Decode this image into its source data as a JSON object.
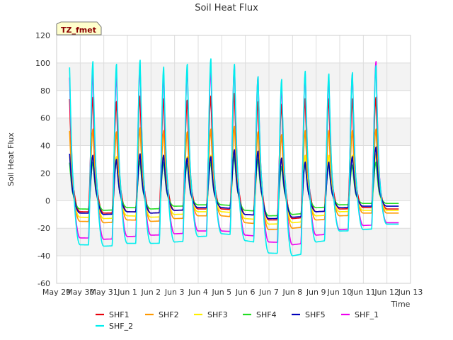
{
  "chart_data": {
    "type": "line",
    "title": "Soil Heat Flux",
    "xlabel": "Time",
    "ylabel": "Soil Heat Flux",
    "badge": "TZ_fmet",
    "ylim": [
      -60,
      120
    ],
    "yticks": [
      -60,
      -40,
      -20,
      0,
      20,
      40,
      60,
      80,
      100,
      120
    ],
    "xlim": [
      0,
      15
    ],
    "xtick_labels": [
      "May 29",
      "May 30",
      "May 31",
      "Jun 1",
      "Jun 2",
      "Jun 3",
      "Jun 4",
      "Jun 5",
      "Jun 6",
      "Jun 7",
      "Jun 8",
      "Jun 9",
      "Jun 10",
      "Jun 11",
      "Jun 12",
      "Jun 13"
    ],
    "grid": true,
    "legend_position": "bottom",
    "colors": {
      "SHF1": "#e8000b",
      "SHF2": "#ff9900",
      "SHF3": "#ffee00",
      "SHF4": "#22dd22",
      "SHF5": "#0000bb",
      "SHF_1": "#ee00ee",
      "SHF_2": "#00eeee"
    },
    "series": [
      {
        "name": "SHF1",
        "peaks": [
          80,
          75,
          72,
          76,
          74,
          73,
          76,
          78,
          72,
          70,
          74,
          74,
          74,
          75
        ],
        "troughs": [
          -5,
          -8,
          -9,
          -8,
          -9,
          -7,
          -6,
          -6,
          -10,
          -14,
          -13,
          -8,
          -6,
          -5,
          -6
        ]
      },
      {
        "name": "SHF2",
        "peaks": [
          55,
          52,
          50,
          53,
          51,
          50,
          52,
          54,
          50,
          48,
          51,
          51,
          51,
          52
        ],
        "troughs": [
          -11,
          -15,
          -16,
          -14,
          -15,
          -13,
          -11,
          -11,
          -16,
          -21,
          -20,
          -14,
          -11,
          -9,
          -9
        ]
      },
      {
        "name": "SHF3",
        "peaks": [
          35,
          33,
          32,
          34,
          33,
          32,
          33,
          35,
          32,
          30,
          33,
          33,
          33,
          34
        ],
        "troughs": [
          -8,
          -12,
          -13,
          -11,
          -12,
          -10,
          -8,
          -8,
          -13,
          -17,
          -16,
          -11,
          -8,
          -7,
          -7
        ]
      },
      {
        "name": "SHF4",
        "peaks": [
          30,
          28,
          29,
          29,
          28,
          27,
          28,
          32,
          30,
          25,
          27,
          26,
          26,
          28
        ],
        "troughs": [
          -3,
          -6,
          -7,
          -5,
          -6,
          -4,
          -3,
          -3,
          -7,
          -11,
          -10,
          -5,
          -3,
          -2,
          -2
        ]
      },
      {
        "name": "SHF5",
        "peaks": [
          37,
          33,
          30,
          34,
          33,
          31,
          32,
          37,
          36,
          31,
          28,
          28,
          32,
          39
        ],
        "troughs": [
          -5,
          -9,
          -10,
          -8,
          -9,
          -7,
          -5,
          -5,
          -10,
          -13,
          -12,
          -8,
          -5,
          -4,
          -4
        ]
      },
      {
        "name": "SHF_1",
        "peaks": [
          97,
          93,
          92,
          98,
          91,
          96,
          97,
          98,
          90,
          83,
          92,
          88,
          92,
          101
        ],
        "troughs": [
          -20,
          -27,
          -28,
          -26,
          -25,
          -24,
          -22,
          -22,
          -25,
          -30,
          -32,
          -25,
          -21,
          -18,
          -16
        ]
      },
      {
        "name": "SHF_2",
        "peaks": [
          105,
          101,
          99,
          102,
          97,
          99,
          103,
          99,
          90,
          88,
          94,
          92,
          93,
          98
        ],
        "troughs": [
          -24,
          -32,
          -33,
          -31,
          -31,
          -30,
          -26,
          -24,
          -29,
          -38,
          -40,
          -30,
          -22,
          -21,
          -17
        ]
      }
    ]
  }
}
